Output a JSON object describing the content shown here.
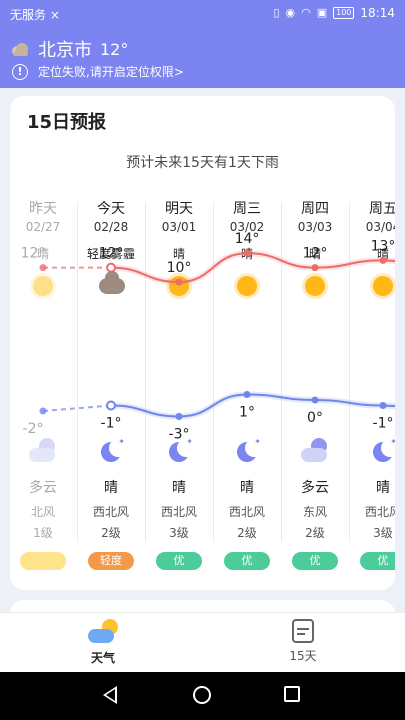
{
  "status_bar": {
    "carrier": "无服务",
    "carrier_x": "×",
    "battery": "100",
    "time": "18:14"
  },
  "header": {
    "icon": "cloud-icon",
    "city": "北京市",
    "current_temp": "12°",
    "location_warning": "定位失败,请开启定位权限>",
    "accent_color": "#7b84f0"
  },
  "forecast": {
    "title": "15日预报",
    "summary": "预计未来15天有1天下雨",
    "days": [
      {
        "day": "昨天",
        "date": "02/27",
        "cond_day": "晴",
        "icon_day": "sun-icon",
        "high": "12°",
        "low": "-2°",
        "icon_night": "cloud-night-icon",
        "cond_night": "多云",
        "wind_dir": "北风",
        "wind_level": "1级",
        "aqi": "",
        "aqi_color": "#ffe38a",
        "past": true
      },
      {
        "day": "今天",
        "date": "02/28",
        "cond_day": "轻度雾霾",
        "icon_day": "haze-icon",
        "high": "12°",
        "low": "-1°",
        "icon_night": "moon-icon",
        "cond_night": "晴",
        "wind_dir": "西北风",
        "wind_level": "2级",
        "aqi": "轻度",
        "aqi_color": "#f29a4a",
        "past": false
      },
      {
        "day": "明天",
        "date": "03/01",
        "cond_day": "晴",
        "icon_day": "sun-icon",
        "high": "10°",
        "low": "-3°",
        "icon_night": "moon-icon",
        "cond_night": "晴",
        "wind_dir": "西北风",
        "wind_level": "3级",
        "aqi": "优",
        "aqi_color": "#4ccb9b",
        "past": false
      },
      {
        "day": "周三",
        "date": "03/02",
        "cond_day": "晴",
        "icon_day": "sun-icon",
        "high": "14°",
        "low": "1°",
        "icon_night": "moon-icon",
        "cond_night": "晴",
        "wind_dir": "西北风",
        "wind_level": "2级",
        "aqi": "优",
        "aqi_color": "#4ccb9b",
        "past": false
      },
      {
        "day": "周四",
        "date": "03/03",
        "cond_day": "晴",
        "icon_day": "sun-icon",
        "high": "12°",
        "low": "0°",
        "icon_night": "cloud-night-icon",
        "cond_night": "多云",
        "wind_dir": "东风",
        "wind_level": "2级",
        "aqi": "优",
        "aqi_color": "#4ccb9b",
        "past": false
      },
      {
        "day": "周五",
        "date": "03/04",
        "cond_day": "晴",
        "icon_day": "sun-icon",
        "high": "13°",
        "low": "-1°",
        "icon_night": "moon-icon",
        "cond_night": "晴",
        "wind_dir": "西北风",
        "wind_level": "3级",
        "aqi": "优",
        "aqi_color": "#4ccb9b",
        "past": false
      }
    ],
    "high_line_color": "#ec6b6b",
    "low_line_color": "#6f86ec"
  },
  "tabbar": {
    "tabs": [
      {
        "label": "天气",
        "icon": "weather-icon",
        "active": true
      },
      {
        "label": "15天",
        "icon": "calendar-icon",
        "active": false
      }
    ]
  }
}
